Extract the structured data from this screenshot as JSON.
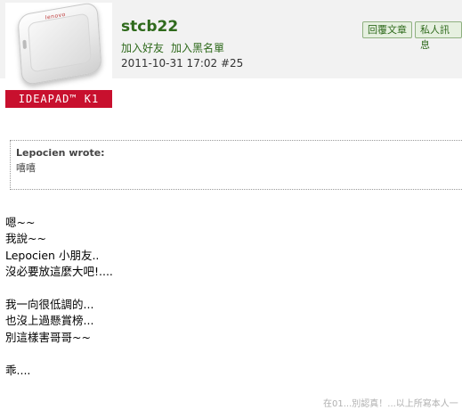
{
  "post": {
    "username": "stcb22",
    "links": [
      "加入好友",
      "加入黑名單"
    ],
    "meta": "2011-10-31 17:02  #25",
    "buttons": {
      "reply": "回覆文章",
      "pm": "私人訊息"
    },
    "avatar": {
      "product_band": "IDEAPAD™ K1",
      "tablet_logo": "lenovo"
    }
  },
  "quote": {
    "author": "Lepocien wrote:",
    "text": "嘻嘻"
  },
  "body": {
    "lines": [
      "嗯~~",
      "我說~~",
      "Lepocien 小朋友..",
      "沒必要放這麼大吧!....",
      "",
      "我一向很低調的...",
      "也沒上過懸賞榜...",
      "別這樣害哥哥~~",
      "",
      "乖...."
    ]
  },
  "signature": "在01...別認真！...以上所寫本人一"
}
